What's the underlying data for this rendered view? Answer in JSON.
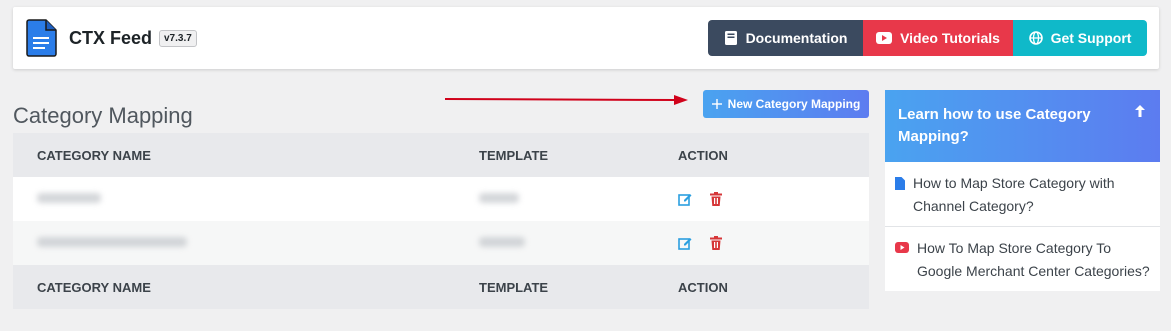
{
  "header": {
    "brand": "CTX Feed",
    "version": "v7.3.7",
    "buttons": {
      "documentation": "Documentation",
      "video_tutorials": "Video Tutorials",
      "get_support": "Get Support"
    }
  },
  "page": {
    "title": "Category Mapping",
    "new_button": "New Category Mapping"
  },
  "table": {
    "columns": [
      "CATEGORY NAME",
      "TEMPLATE",
      "ACTION"
    ]
  },
  "sidebar": {
    "title": "Learn how to use Category Mapping?",
    "items": [
      "How to Map Store Category with Channel Category?",
      "How To Map Store Category To Google Merchant Center Categories?"
    ]
  },
  "colors": {
    "accent": "#4aa3f0",
    "doc_button": "#3b4a5f",
    "video_button": "#e8384a",
    "support_button": "#0fb9c9",
    "edit_icon": "#2b9fe0",
    "delete_icon": "#d63638"
  }
}
